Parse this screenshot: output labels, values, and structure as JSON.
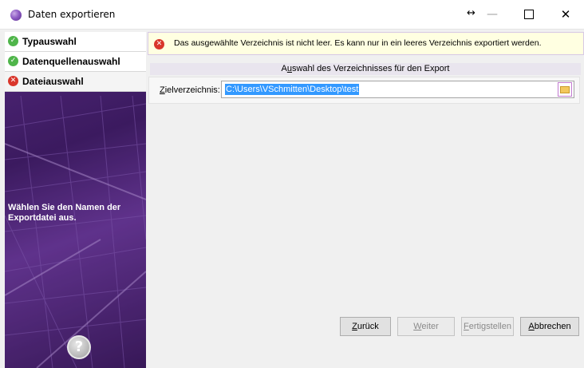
{
  "window": {
    "title": "Daten exportieren"
  },
  "steps": [
    {
      "label": "Typauswahl",
      "status": "ok",
      "glyph": "✓"
    },
    {
      "label": "Datenquellenauswahl",
      "status": "ok",
      "glyph": "✓"
    },
    {
      "label": "Dateiauswahl",
      "status": "error",
      "glyph": "✕"
    }
  ],
  "sidebar": {
    "hint": "Wählen Sie den Namen der Exportdatei aus.",
    "help_glyph": "?"
  },
  "error": {
    "glyph": "✕",
    "message": "Das ausgewählte Verzeichnis ist nicht leer. Es kann nur in ein leeres Verzeichnis exportiert werden."
  },
  "group": {
    "header_prefix": "A",
    "header_accel": "u",
    "header_suffix": "swahl des Verzeichnisses für den Export"
  },
  "target_dir": {
    "label_accel": "Z",
    "label_suffix": "ielverzeichnis:",
    "value": "C:\\Users\\VSchmitten\\Desktop\\test"
  },
  "buttons": {
    "back": {
      "accel": "Z",
      "rest": "urück"
    },
    "next": {
      "accel": "W",
      "rest": "eiter"
    },
    "finish": {
      "accel": "F",
      "rest": "ertigstellen"
    },
    "cancel": {
      "accel": "A",
      "rest": "bbrechen"
    }
  },
  "colors": {
    "ok": "#4fb54a",
    "error": "#d9362b",
    "sidebar": "#4a2578",
    "selection": "#3399ff",
    "error_bar": "#ffffe1"
  }
}
